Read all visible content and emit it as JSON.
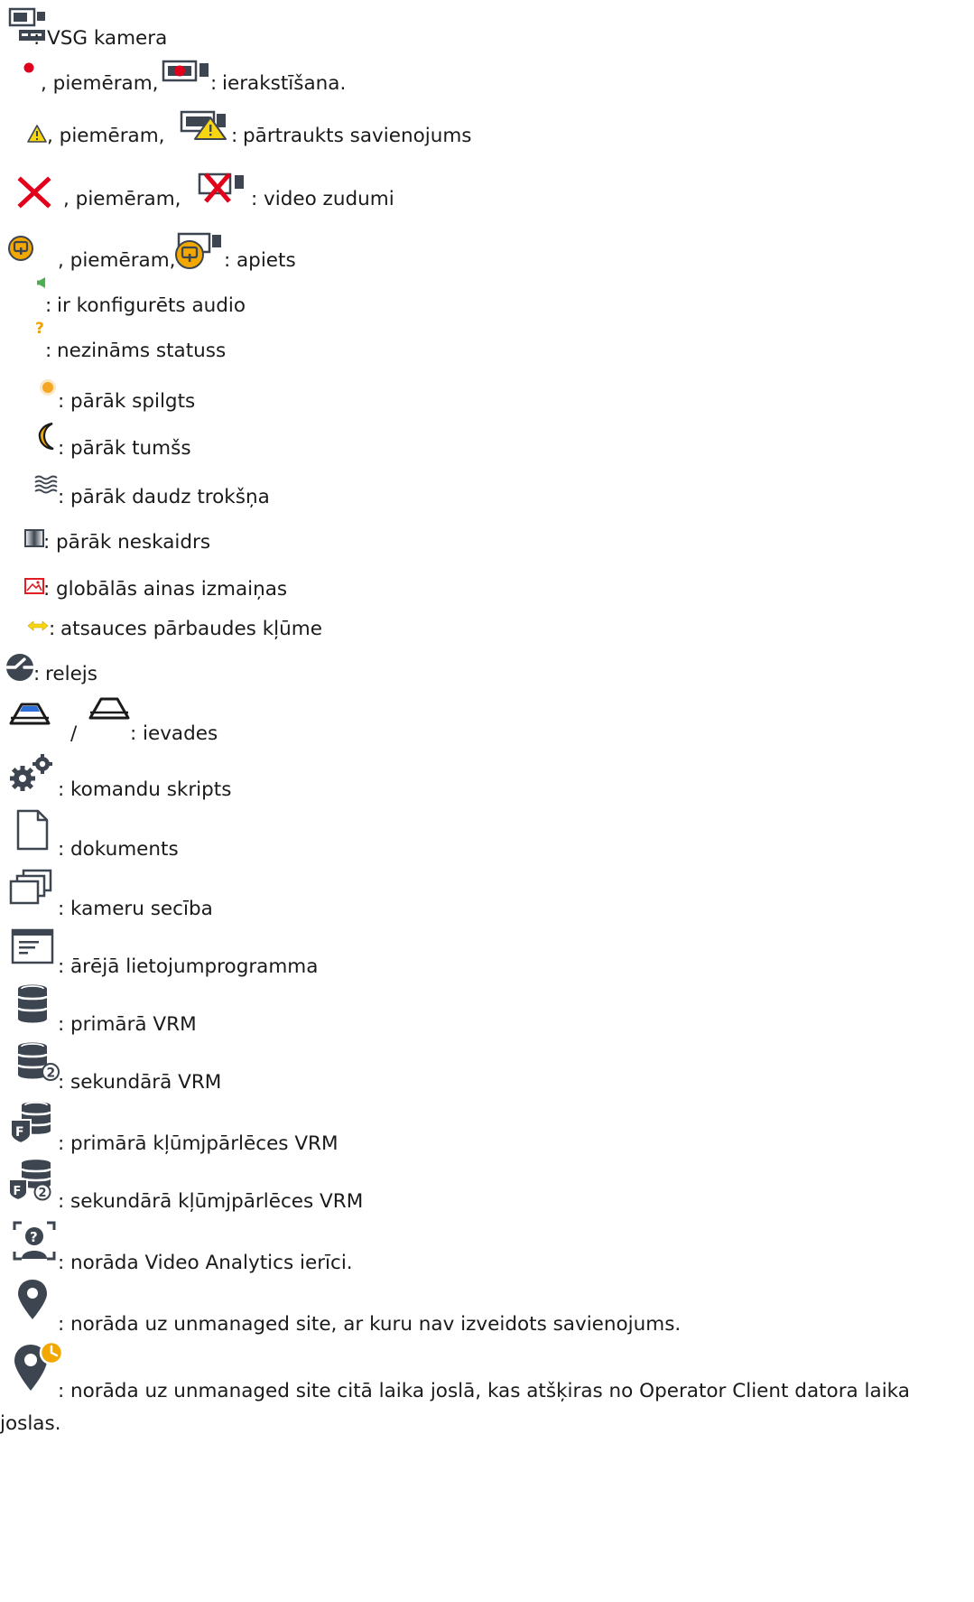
{
  "legend": {
    "vsg_camera": "VSG kamera",
    "recording_prefix": ", piemēram,",
    "recording": "ierakstīšana.",
    "disconnected_prefix": ", piemēram,",
    "disconnected": "pārtraukts savienojums",
    "video_loss_prefix": ", piemēram,",
    "video_loss": "video zudumi",
    "bypassed_prefix": ", piemēram,",
    "bypassed": "apiets",
    "audio": "ir konfigurēts audio",
    "unknown_state": "nezināms statuss",
    "too_bright": "pārāk spilgts",
    "too_dark": "pārāk tumšs",
    "too_noisy": "pārāk daudz trokšņa",
    "too_blurry": "pārāk neskaidrs",
    "global_change": "globālās ainas izmaiņas",
    "reference_check_failure": "atsauces pārbaudes kļūme",
    "relay": "relejs",
    "inputs_separator": "/",
    "inputs": "ievades",
    "command_script": "komandu skripts",
    "document": "dokuments",
    "camera_sequence": "kameru secība",
    "external_application": "ārējā lietojumprogramma",
    "primary_vrm": "primārā VRM",
    "secondary_vrm": "sekundārā VRM",
    "primary_failover_vrm": "primārā kļūmjpārlēces VRM",
    "secondary_failover_vrm": "sekundārā kļūmjpārlēces VRM",
    "video_analytics": "norāda Video Analytics ierīci.",
    "unmanaged_site": "norāda uz unmanaged site, ar kuru nav izveidots savienojums.",
    "unmanaged_site_timezone_line1": "norāda uz unmanaged site citā laika joslā, kas atšķiras no Operator Client datora laika",
    "unmanaged_site_timezone_line2": "joslas."
  },
  "colors": {
    "text": "#1a1a1a",
    "icon_dark": "#3c4550",
    "recording_red": "#e0001b",
    "warning_yellow": "#f7d511",
    "video_loss_red": "#e3001b",
    "bypass_orange": "#f2a800",
    "audio_green": "#4caf50",
    "unknown_orange": "#f0a000",
    "storage_blue": "#2b6fd6",
    "change_red": "#e31b23"
  }
}
